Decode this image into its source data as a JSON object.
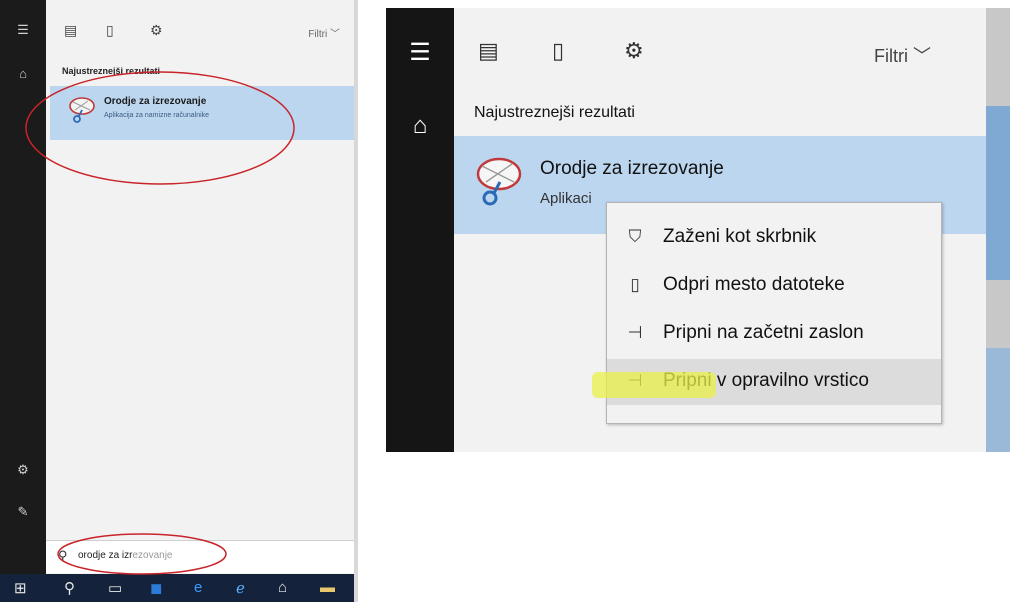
{
  "left": {
    "toolbar": {
      "filter": "Filtri"
    },
    "best_match_heading": "Najustreznejši rezultati",
    "result": {
      "title": "Orodje za izrezovanje",
      "subtitle": "Aplikacija za namizne računalnike"
    },
    "search": {
      "typed": "orodje za izr",
      "suggest": "ezovanje"
    }
  },
  "right": {
    "toolbar": {
      "filter": "Filtri"
    },
    "best_match_heading": "Najustreznejši rezultati",
    "result": {
      "title": "Orodje za izrezovanje",
      "subtitle": "Aplikaci"
    },
    "context_menu": {
      "items": [
        {
          "label": "Zaženi kot skrbnik",
          "icon": "run-as-admin-icon"
        },
        {
          "label": "Odpri mesto datoteke",
          "icon": "open-file-location-icon"
        },
        {
          "label": "Pripni na začetni zaslon",
          "icon": "pin-icon"
        },
        {
          "label": "Pripni v opravilno vrstico",
          "icon": "pin-icon"
        }
      ]
    }
  },
  "colors": {
    "accent": "#bcd6ef",
    "rail": "#151515",
    "highlight": "#e9f04a",
    "taskbar": "#14233b"
  }
}
